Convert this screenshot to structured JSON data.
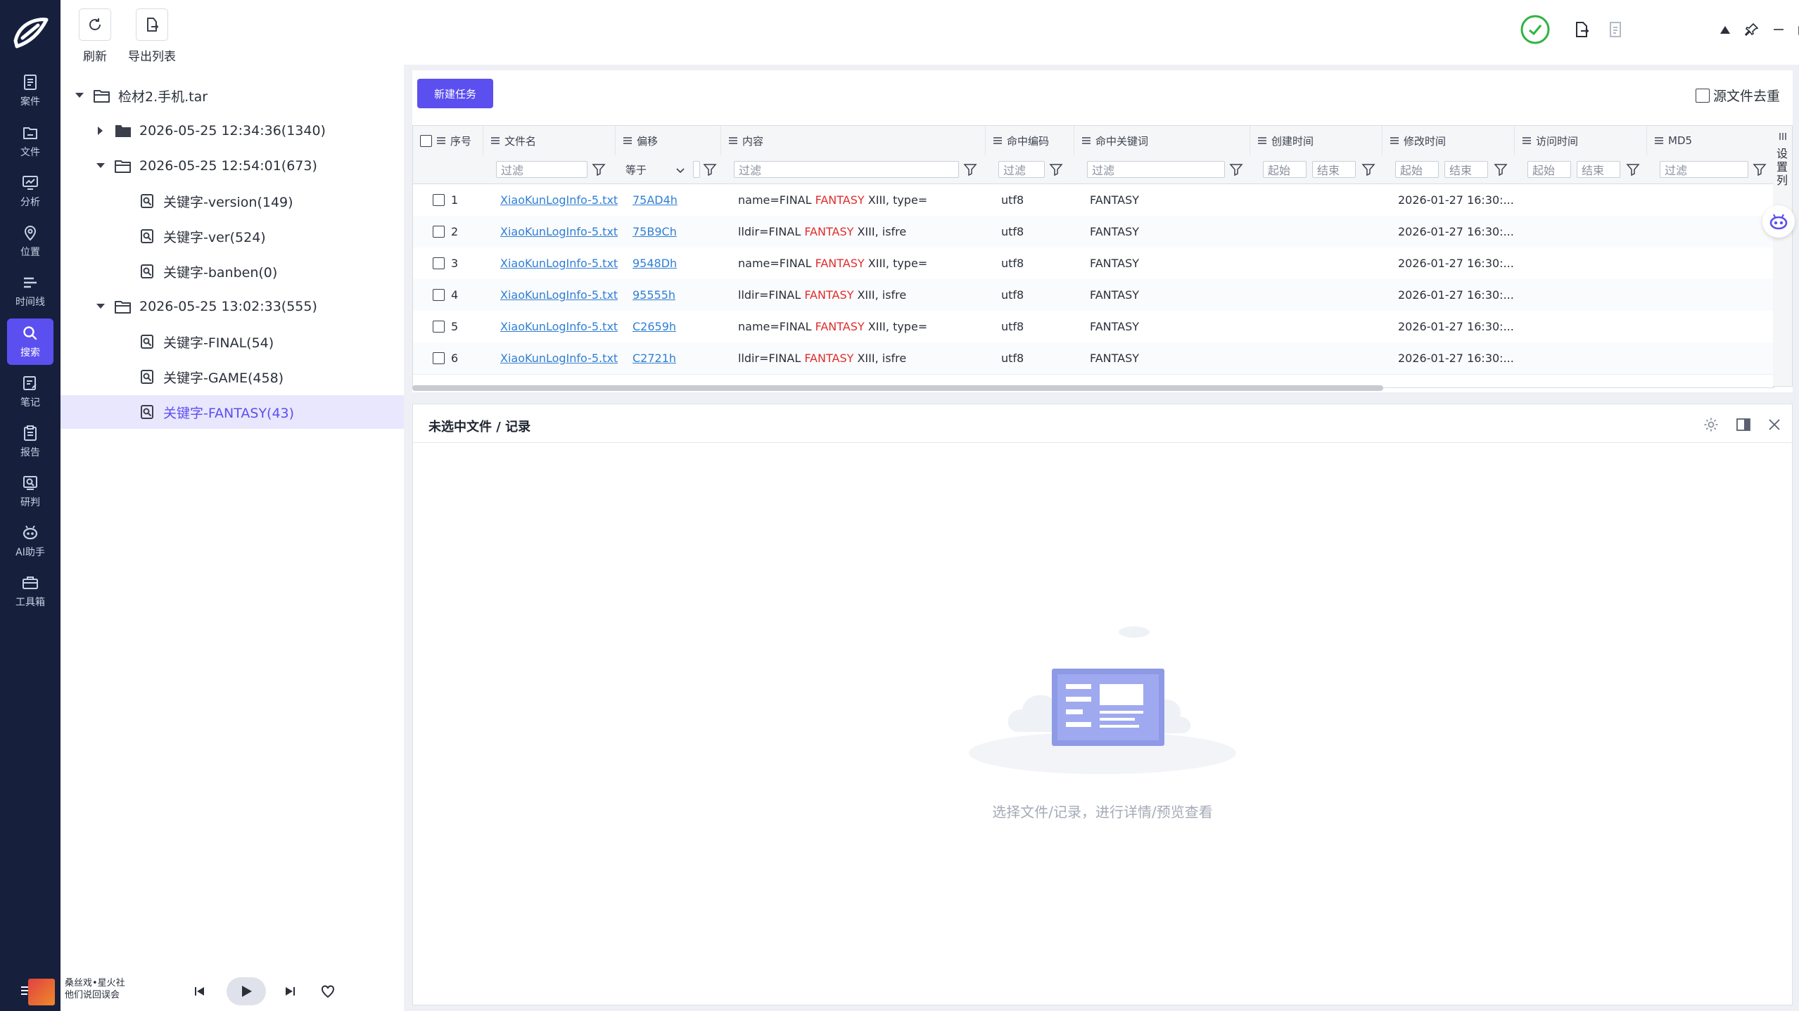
{
  "toolbar": {
    "refresh_label": "刷新",
    "export_label": "导出列表"
  },
  "nav": {
    "items": [
      {
        "label": "案件",
        "icon": "case-icon"
      },
      {
        "label": "文件",
        "icon": "file-icon"
      },
      {
        "label": "分析",
        "icon": "analysis-icon"
      },
      {
        "label": "位置",
        "icon": "location-icon"
      },
      {
        "label": "时间线",
        "icon": "timeline-icon"
      },
      {
        "label": "搜索",
        "icon": "search-icon",
        "active": true
      },
      {
        "label": "笔记",
        "icon": "note-icon"
      },
      {
        "label": "报告",
        "icon": "report-icon"
      },
      {
        "label": "研判",
        "icon": "judge-icon"
      },
      {
        "label": "AI助手",
        "icon": "ai-assistant-icon"
      },
      {
        "label": "工具箱",
        "icon": "toolbox-icon"
      }
    ]
  },
  "tree": {
    "root": "检材2.手机.tar",
    "items": [
      {
        "label": "2026-05-25 12:34:36(1340)",
        "expanded": false
      },
      {
        "label": "2026-05-25 12:54:01(673)",
        "expanded": true
      },
      {
        "label": "关键字-version(149)"
      },
      {
        "label": "关键字-ver(524)"
      },
      {
        "label": "关键字-banben(0)"
      },
      {
        "label": "2026-05-25 13:02:33(555)",
        "expanded": true
      },
      {
        "label": "关键字-FINAL(54)"
      },
      {
        "label": "关键字-GAME(458)"
      },
      {
        "label": "关键字-FANTASY(43)",
        "selected": true
      }
    ]
  },
  "player": {
    "line1": "桑丝戏•星火社",
    "line2": "他们说回误会"
  },
  "results": {
    "new_task_label": "新建任务",
    "dedupe_label": "源文件去重",
    "columns": [
      "序号",
      "文件名",
      "偏移",
      "内容",
      "命中编码",
      "命中关键词",
      "创建时间",
      "修改时间",
      "访问时间",
      "MD5"
    ],
    "filters": {
      "filter": "过滤",
      "equals": "等于",
      "start": "起始",
      "end": "结束"
    },
    "rows": [
      {
        "idx": "1",
        "file": "XiaoKunLogInfo-5.txt",
        "offset": "75AD4h",
        "pre": "name=FINAL ",
        "kw": "FANTASY",
        "post": " XIII, type=",
        "enc": "utf8",
        "hit": "FANTASY",
        "mtime": "2026-01-27 16:30:..."
      },
      {
        "idx": "2",
        "file": "XiaoKunLogInfo-5.txt",
        "offset": "75B9Ch",
        "pre": "lldir=FINAL ",
        "kw": "FANTASY",
        "post": " XIII, isfre",
        "enc": "utf8",
        "hit": "FANTASY",
        "mtime": "2026-01-27 16:30:..."
      },
      {
        "idx": "3",
        "file": "XiaoKunLogInfo-5.txt",
        "offset": "9548Dh",
        "pre": "name=FINAL ",
        "kw": "FANTASY",
        "post": " XIII, type=",
        "enc": "utf8",
        "hit": "FANTASY",
        "mtime": "2026-01-27 16:30:..."
      },
      {
        "idx": "4",
        "file": "XiaoKunLogInfo-5.txt",
        "offset": "95555h",
        "pre": "lldir=FINAL ",
        "kw": "FANTASY",
        "post": " XIII, isfre",
        "enc": "utf8",
        "hit": "FANTASY",
        "mtime": "2026-01-27 16:30:..."
      },
      {
        "idx": "5",
        "file": "XiaoKunLogInfo-5.txt",
        "offset": "C2659h",
        "pre": "name=FINAL ",
        "kw": "FANTASY",
        "post": " XIII, type=",
        "enc": "utf8",
        "hit": "FANTASY",
        "mtime": "2026-01-27 16:30:..."
      },
      {
        "idx": "6",
        "file": "XiaoKunLogInfo-5.txt",
        "offset": "C2721h",
        "pre": "lldir=FINAL ",
        "kw": "FANTASY",
        "post": " XIII, isfre",
        "enc": "utf8",
        "hit": "FANTASY",
        "mtime": "2026-01-27 16:30:..."
      }
    ],
    "settings_strip": "设置列"
  },
  "detail": {
    "title": "未选中文件 / 记录",
    "empty_text": "选择文件/记录，进行详情/预览查看"
  },
  "colors": {
    "accent": "#5b4ff0",
    "rail": "#16203d",
    "highlight": "#e02d2d",
    "link": "#2f7fd6",
    "status_ok": "#2fb344"
  }
}
